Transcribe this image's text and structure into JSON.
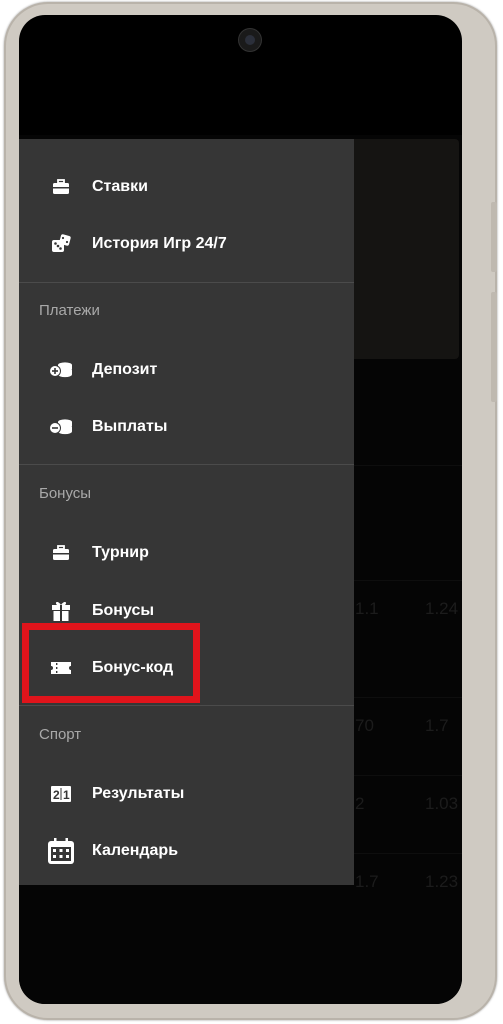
{
  "menu": {
    "top_items": [
      {
        "label": "Ставки",
        "icon": "briefcase-icon"
      },
      {
        "label": "История Игр 24/7",
        "icon": "dice-icon"
      }
    ],
    "sections": [
      {
        "header": "Платежи",
        "items": [
          {
            "label": "Депозит",
            "icon": "coins-plus-icon"
          },
          {
            "label": "Выплаты",
            "icon": "coins-minus-icon"
          }
        ]
      },
      {
        "header": "Бонусы",
        "items": [
          {
            "label": "Турнир",
            "icon": "briefcase-icon"
          },
          {
            "label": "Бонусы",
            "icon": "gift-icon"
          },
          {
            "label": "Бонус-код",
            "icon": "ticket-icon",
            "highlighted": true
          }
        ]
      },
      {
        "header": "Спорт",
        "items": [
          {
            "label": "Результаты",
            "icon": "scoreboard-icon"
          },
          {
            "label": "Календарь",
            "icon": "calendar-icon"
          }
        ]
      }
    ]
  },
  "background_rows": [
    {
      "a": "",
      "b": ""
    },
    {
      "a": "1.1",
      "b": "1.24"
    },
    {
      "a": "70",
      "b": "1.7"
    },
    {
      "a": "2",
      "b": "1.03"
    },
    {
      "a": "1.7",
      "b": "1.23"
    }
  ],
  "colors": {
    "drawer_bg": "#363636",
    "highlight": "#e0141b",
    "section_header": "#a9a9a9"
  }
}
